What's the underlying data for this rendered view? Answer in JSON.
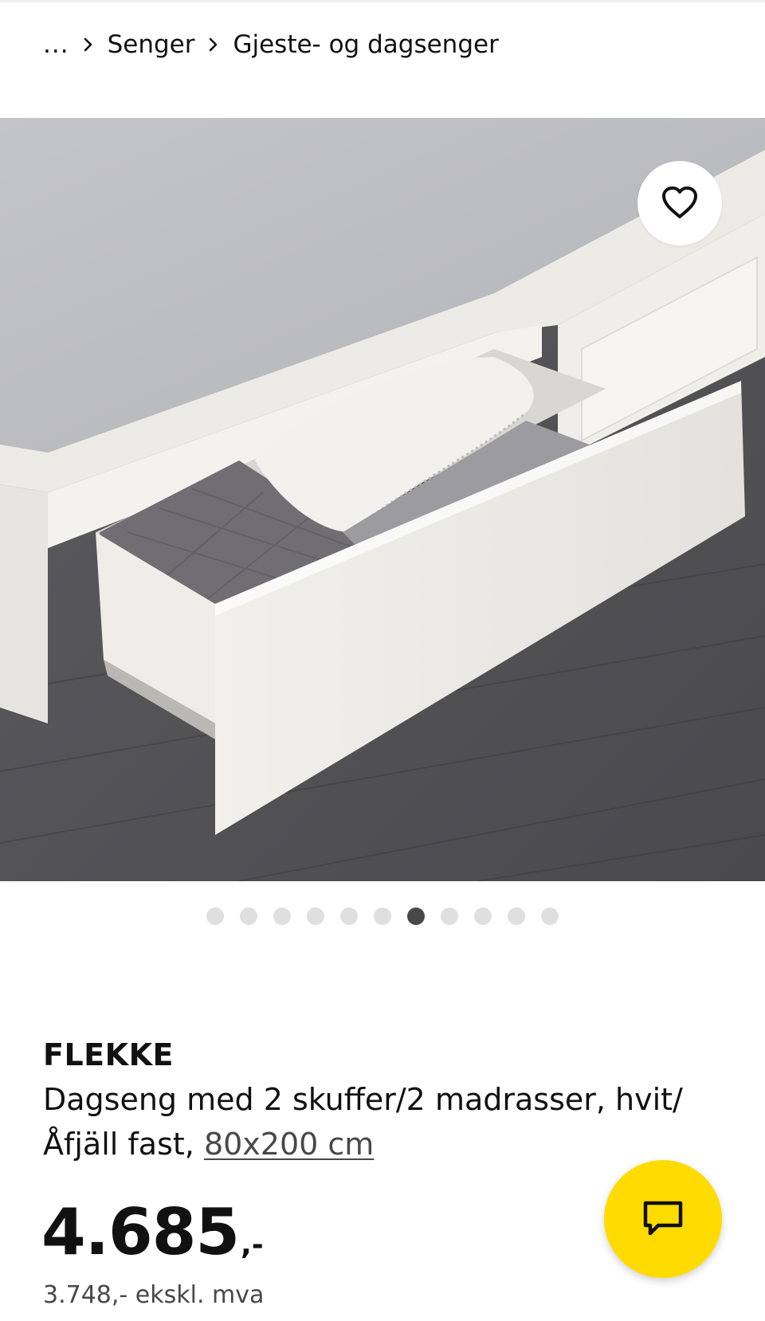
{
  "breadcrumb": {
    "ellipsis": "...",
    "items": [
      "Senger",
      "Gjeste- og dagsenger"
    ]
  },
  "gallery": {
    "favorite_icon": "heart-icon",
    "total_images": 11,
    "active_index": 6
  },
  "product": {
    "name": "FLEKKE",
    "description": "Dagseng med 2 skuffer/2 madrasser, hvit/ Åfjäll fast,",
    "size": "80x200 cm",
    "price": "4.685",
    "price_suffix": ",-",
    "price_ex_vat": "3.748,- ekskl. mva"
  },
  "chat": {
    "icon": "chat-bubble-icon"
  },
  "colors": {
    "accent_yellow": "#FFDB00",
    "text": "#111111",
    "muted_text": "#484848",
    "dot_inactive": "#DFDFDF",
    "dot_active": "#484848"
  }
}
